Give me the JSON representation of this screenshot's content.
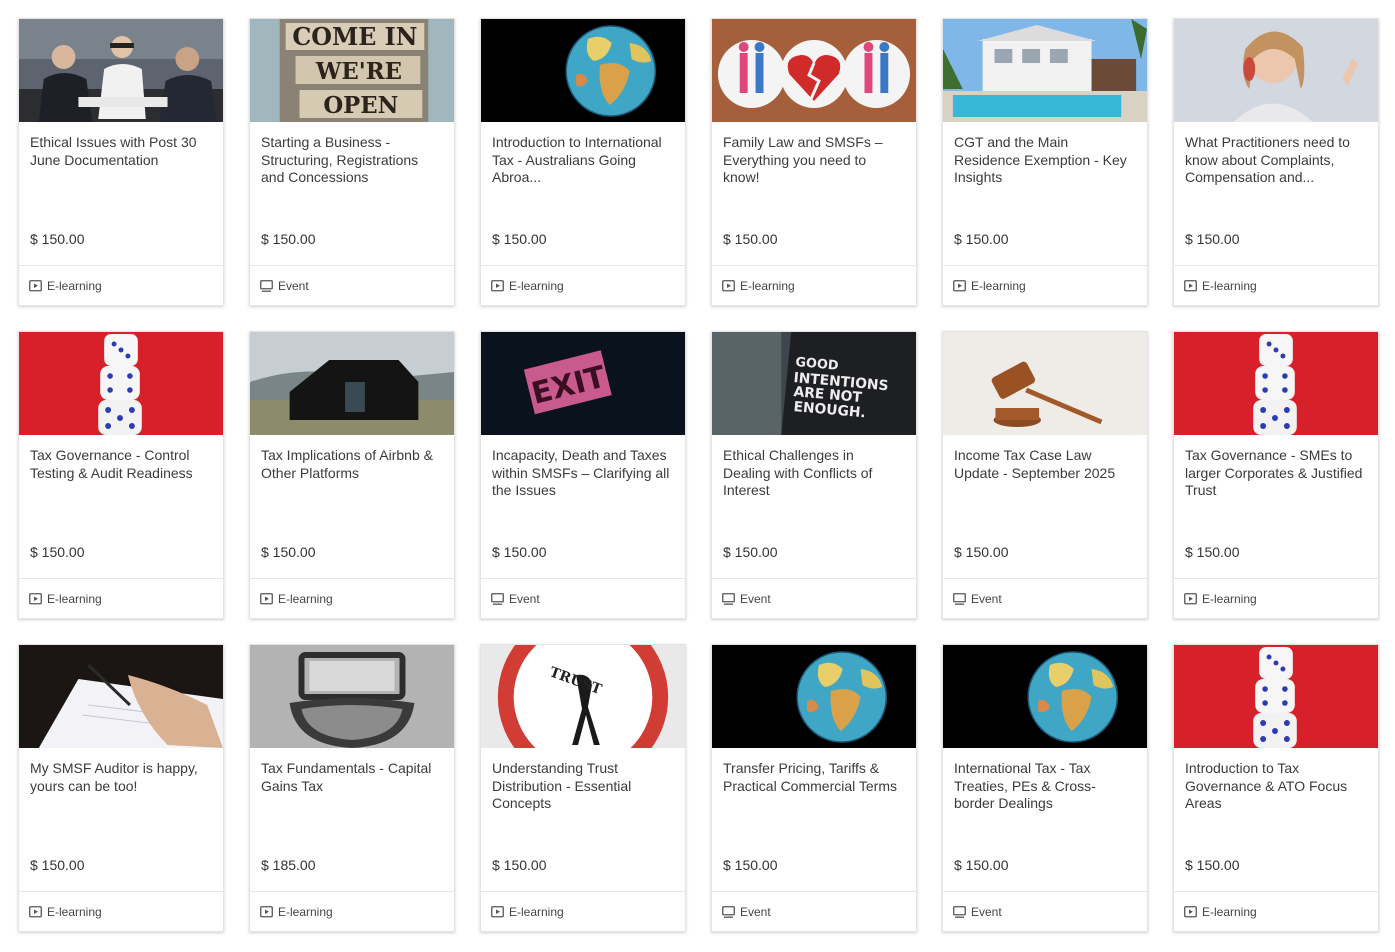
{
  "cards": [
    {
      "title": "Ethical Issues with Post 30 June Documentation",
      "price": "$ 150.00",
      "type": "E-learning",
      "image": "business-meeting"
    },
    {
      "title": "Starting a Business - Structuring, Registrations and Concessions",
      "price": "$ 150.00",
      "type": "Event",
      "image": "come-in-open-sign",
      "image_text": [
        "COME IN",
        "WE'RE",
        "OPEN"
      ]
    },
    {
      "title": "Introduction to International Tax - Australians Going Abroa...",
      "price": "$ 150.00",
      "type": "E-learning",
      "image": "globe"
    },
    {
      "title": "Family Law and SMSFs – Everything you need to know!",
      "price": "$ 150.00",
      "type": "E-learning",
      "image": "broken-heart-badges"
    },
    {
      "title": "CGT and the Main Residence Exemption - Key Insights",
      "price": "$ 150.00",
      "type": "E-learning",
      "image": "house-pool"
    },
    {
      "title": "What Practitioners need to know about Complaints, Compensation and...",
      "price": "$ 150.00",
      "type": "E-learning",
      "image": "woman-on-phone"
    },
    {
      "title": "Tax Governance - Control Testing & Audit Readiness",
      "price": "$ 150.00",
      "type": "E-learning",
      "image": "dice-stack"
    },
    {
      "title": "Tax Implications of Airbnb & Other Platforms",
      "price": "$ 150.00",
      "type": "E-learning",
      "image": "black-cabin"
    },
    {
      "title": "Incapacity, Death and Taxes within SMSFs – Clarifying all the Issues",
      "price": "$ 150.00",
      "type": "Event",
      "image": "exit-sign",
      "image_text": [
        "EXIT"
      ]
    },
    {
      "title": "Ethical Challenges in Dealing with Conflicts of Interest",
      "price": "$ 150.00",
      "type": "Event",
      "image": "good-intentions-shirt",
      "image_text": [
        "GOOD",
        "INTENTIONS",
        "ARE NOT",
        "ENOUGH."
      ]
    },
    {
      "title": "Income Tax Case Law Update - September 2025",
      "price": "$ 150.00",
      "type": "Event",
      "image": "gavel"
    },
    {
      "title": "Tax Governance - SMEs to larger Corporates & Justified Trust",
      "price": "$ 150.00",
      "type": "E-learning",
      "image": "dice-stack"
    },
    {
      "title": "My SMSF Auditor is happy, yours can be too!",
      "price": "$ 150.00",
      "type": "E-learning",
      "image": "signing-document"
    },
    {
      "title": "Tax Fundamentals - Capital Gains Tax",
      "price": "$ 185.00",
      "type": "E-learning",
      "image": "drawer-handle"
    },
    {
      "title": "Understanding Trust Distribution - Essential Concepts",
      "price": "$ 150.00",
      "type": "E-learning",
      "image": "trust-sign",
      "image_text": [
        "TRUST"
      ]
    },
    {
      "title": "Transfer Pricing, Tariffs & Practical Commercial Terms",
      "price": "$ 150.00",
      "type": "Event",
      "image": "globe"
    },
    {
      "title": "International Tax - Tax Treaties, PEs & Cross-border Dealings",
      "price": "$ 150.00",
      "type": "Event",
      "image": "globe"
    },
    {
      "title": "Introduction to Tax Governance & ATO Focus Areas",
      "price": "$ 150.00",
      "type": "E-learning",
      "image": "dice-stack"
    }
  ],
  "icons": {
    "E-learning": "play-screen-icon",
    "Event": "monitor-icon"
  }
}
